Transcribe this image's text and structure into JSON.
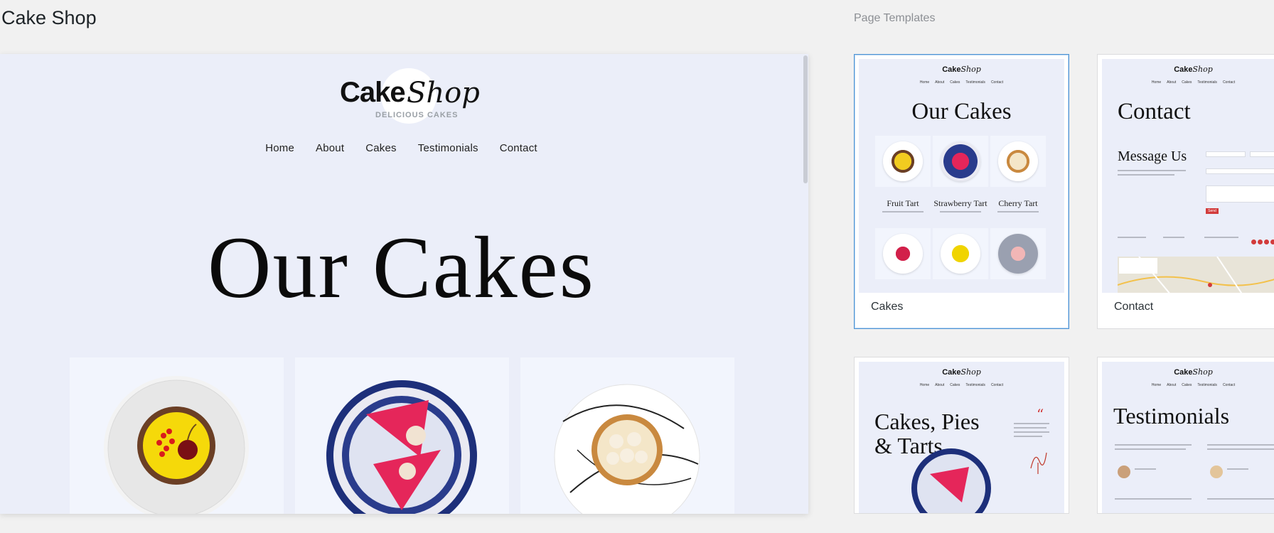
{
  "header": {
    "title": "Cake Shop",
    "section_label": "Page Templates"
  },
  "preview": {
    "logo": {
      "cake": "Cake",
      "shop": "Shop",
      "tagline": "DELICIOUS CAKES"
    },
    "nav": [
      "Home",
      "About",
      "Cakes",
      "Testimonials",
      "Contact"
    ],
    "hero_title": "Our Cakes"
  },
  "templates": [
    {
      "caption": "Cakes",
      "selected": true,
      "logo_cake": "Cake",
      "logo_shop": "Shop",
      "nav": [
        "Home",
        "About",
        "Cakes",
        "Testimonials",
        "Contact"
      ],
      "title": "Our Cakes",
      "items": [
        "Fruit Tart",
        "Strawberry Tart",
        "Cherry Tart"
      ]
    },
    {
      "caption": "Contact",
      "selected": false,
      "logo_cake": "Cake",
      "logo_shop": "Shop",
      "nav": [
        "Home",
        "About",
        "Cakes",
        "Testimonials",
        "Contact"
      ],
      "title": "Contact",
      "subtitle": "Message Us",
      "button": "Send"
    },
    {
      "caption": "",
      "selected": false,
      "logo_cake": "Cake",
      "logo_shop": "Shop",
      "nav": [
        "Home",
        "About",
        "Cakes",
        "Testimonials",
        "Contact"
      ],
      "title_line1": "Cakes, Pies",
      "title_line2": "& Tarts"
    },
    {
      "caption": "",
      "selected": false,
      "logo_cake": "Cake",
      "logo_shop": "Shop",
      "nav": [
        "Home",
        "About",
        "Cakes",
        "Testimonials",
        "Contact"
      ],
      "title": "Testimonials"
    }
  ],
  "colors": {
    "background": "#f1f1f1",
    "preview_bg": "#ebeef9",
    "selected_border": "#4f94d4",
    "accent_red": "#d23b3b"
  }
}
